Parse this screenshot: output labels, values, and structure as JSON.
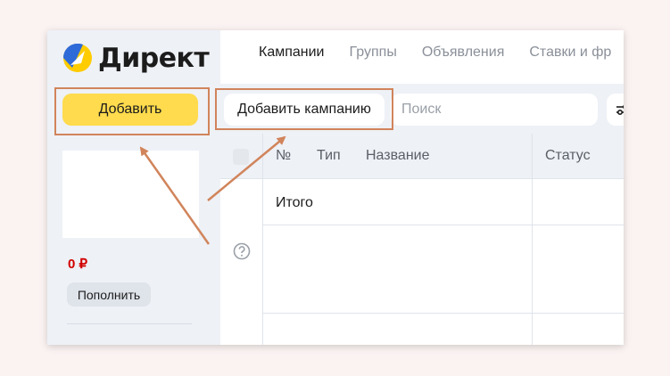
{
  "logo": {
    "text": "Директ"
  },
  "tabs": [
    {
      "label": "Кампании",
      "active": true
    },
    {
      "label": "Группы",
      "active": false
    },
    {
      "label": "Объявления",
      "active": false
    },
    {
      "label": "Ставки и фр",
      "active": false
    }
  ],
  "toolbar": {
    "add_label": "Добавить",
    "add_campaign_label": "Добавить кампанию",
    "search_placeholder": "Поиск",
    "filter_icon": "filter-icon"
  },
  "sidebar": {
    "balance": "0 ₽",
    "topup_label": "Пополнить"
  },
  "table": {
    "columns": [
      "№",
      "Тип",
      "Название",
      "Статус"
    ],
    "total_label": "Итого"
  },
  "colors": {
    "accent": "#ffdb4d",
    "highlight": "#d1845b",
    "balance": "#d10000"
  }
}
